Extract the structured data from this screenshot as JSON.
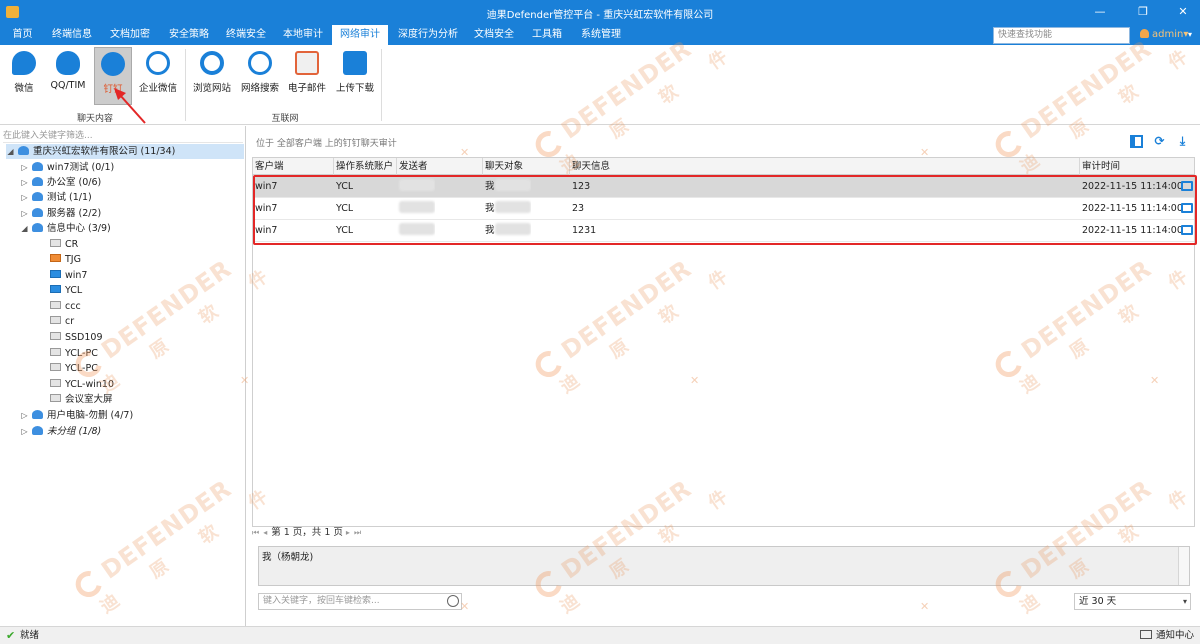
{
  "window": {
    "title": "迪果Defender管控平台 - 重庆兴虹宏软件有限公司",
    "minimize": "—",
    "restore": "❐",
    "close": "✕"
  },
  "menubar": {
    "items": [
      "首页",
      "终端信息",
      "文档加密",
      "安全策略",
      "终端安全",
      "本地审计",
      "网络审计",
      "深度行为分析",
      "文档安全",
      "工具箱",
      "系统管理"
    ],
    "active_index": 6,
    "search_placeholder": "快速查找功能",
    "user": "admin",
    "user_caret": "▾",
    "more_caret": "▾"
  },
  "ribbon": {
    "groups": [
      {
        "label": "聊天内容",
        "buttons": [
          "微信",
          "QQ/TIM",
          "钉钉",
          "企业微信"
        ]
      },
      {
        "label": "互联网",
        "buttons": [
          "浏览网站",
          "网络搜索",
          "电子邮件",
          "上传下载"
        ]
      }
    ],
    "selected_button": "钉钉",
    "icon_names": [
      "wechat-icon",
      "qq-icon",
      "dingtalk-icon",
      "wecom-icon",
      "browser-icon",
      "web-search-icon",
      "email-icon",
      "upload-download-icon"
    ]
  },
  "tree": {
    "filter_placeholder": "在此键入关键字筛选...",
    "collapse_glyph": "◢",
    "expand_glyph": "▷",
    "root": "重庆兴虹宏软件有限公司 (11/34)",
    "groups": [
      {
        "label": "win7测试 (0/1)"
      },
      {
        "label": "办公室 (0/6)"
      },
      {
        "label": "测试 (1/1)"
      },
      {
        "label": "服务器 (2/2)"
      },
      {
        "label": "信息中心 (3/9)",
        "expanded": true,
        "children": [
          "CR",
          "TJG",
          "win7",
          "YCL",
          "ccc",
          "cr",
          "SSD109",
          "YCL-PC",
          "YCL-PC",
          "YCL-win10",
          "会议室大屏"
        ]
      },
      {
        "label": "用户电脑-勿删 (4/7)"
      },
      {
        "label": "未分组 (1/8)"
      }
    ]
  },
  "content": {
    "location": "位于 全部客户端 上的钉钉聊天审计",
    "columns": [
      "客户端",
      "操作系统账户",
      "发送者",
      "聊天对象",
      "聊天信息",
      "审计时间"
    ],
    "rows": [
      {
        "client": "win7",
        "account": "YCL",
        "sender": "",
        "target": "我",
        "message": "123",
        "time": "2022-11-15 11:14:00"
      },
      {
        "client": "win7",
        "account": "YCL",
        "sender": "",
        "target": "我",
        "message": "23",
        "time": "2022-11-15 11:14:00"
      },
      {
        "client": "win7",
        "account": "YCL",
        "sender": "",
        "target": "我",
        "message": "1231",
        "time": "2022-11-15 11:14:00"
      }
    ],
    "pager_text": "第 1 页，共 1 页",
    "pager_first": "⏮",
    "pager_prev": "◂",
    "pager_next": "▸",
    "pager_last": "⏭",
    "message_detail": "我（杨朝龙)",
    "keyword_placeholder": "键入关键字，按回车键检索...",
    "range_value": "近 30 天",
    "range_caret": "▾",
    "toolbar_icons": [
      "layout-icon",
      "refresh-icon",
      "download-icon"
    ]
  },
  "status": {
    "ready": "就绪",
    "notify": "通知中心"
  },
  "watermark": {
    "brand": "DEFENDER",
    "sub": "迪 原 软 件"
  },
  "colors": {
    "accent": "#1a80d8",
    "highlight": "#e32727",
    "selected_row": "#d8d8d8"
  }
}
